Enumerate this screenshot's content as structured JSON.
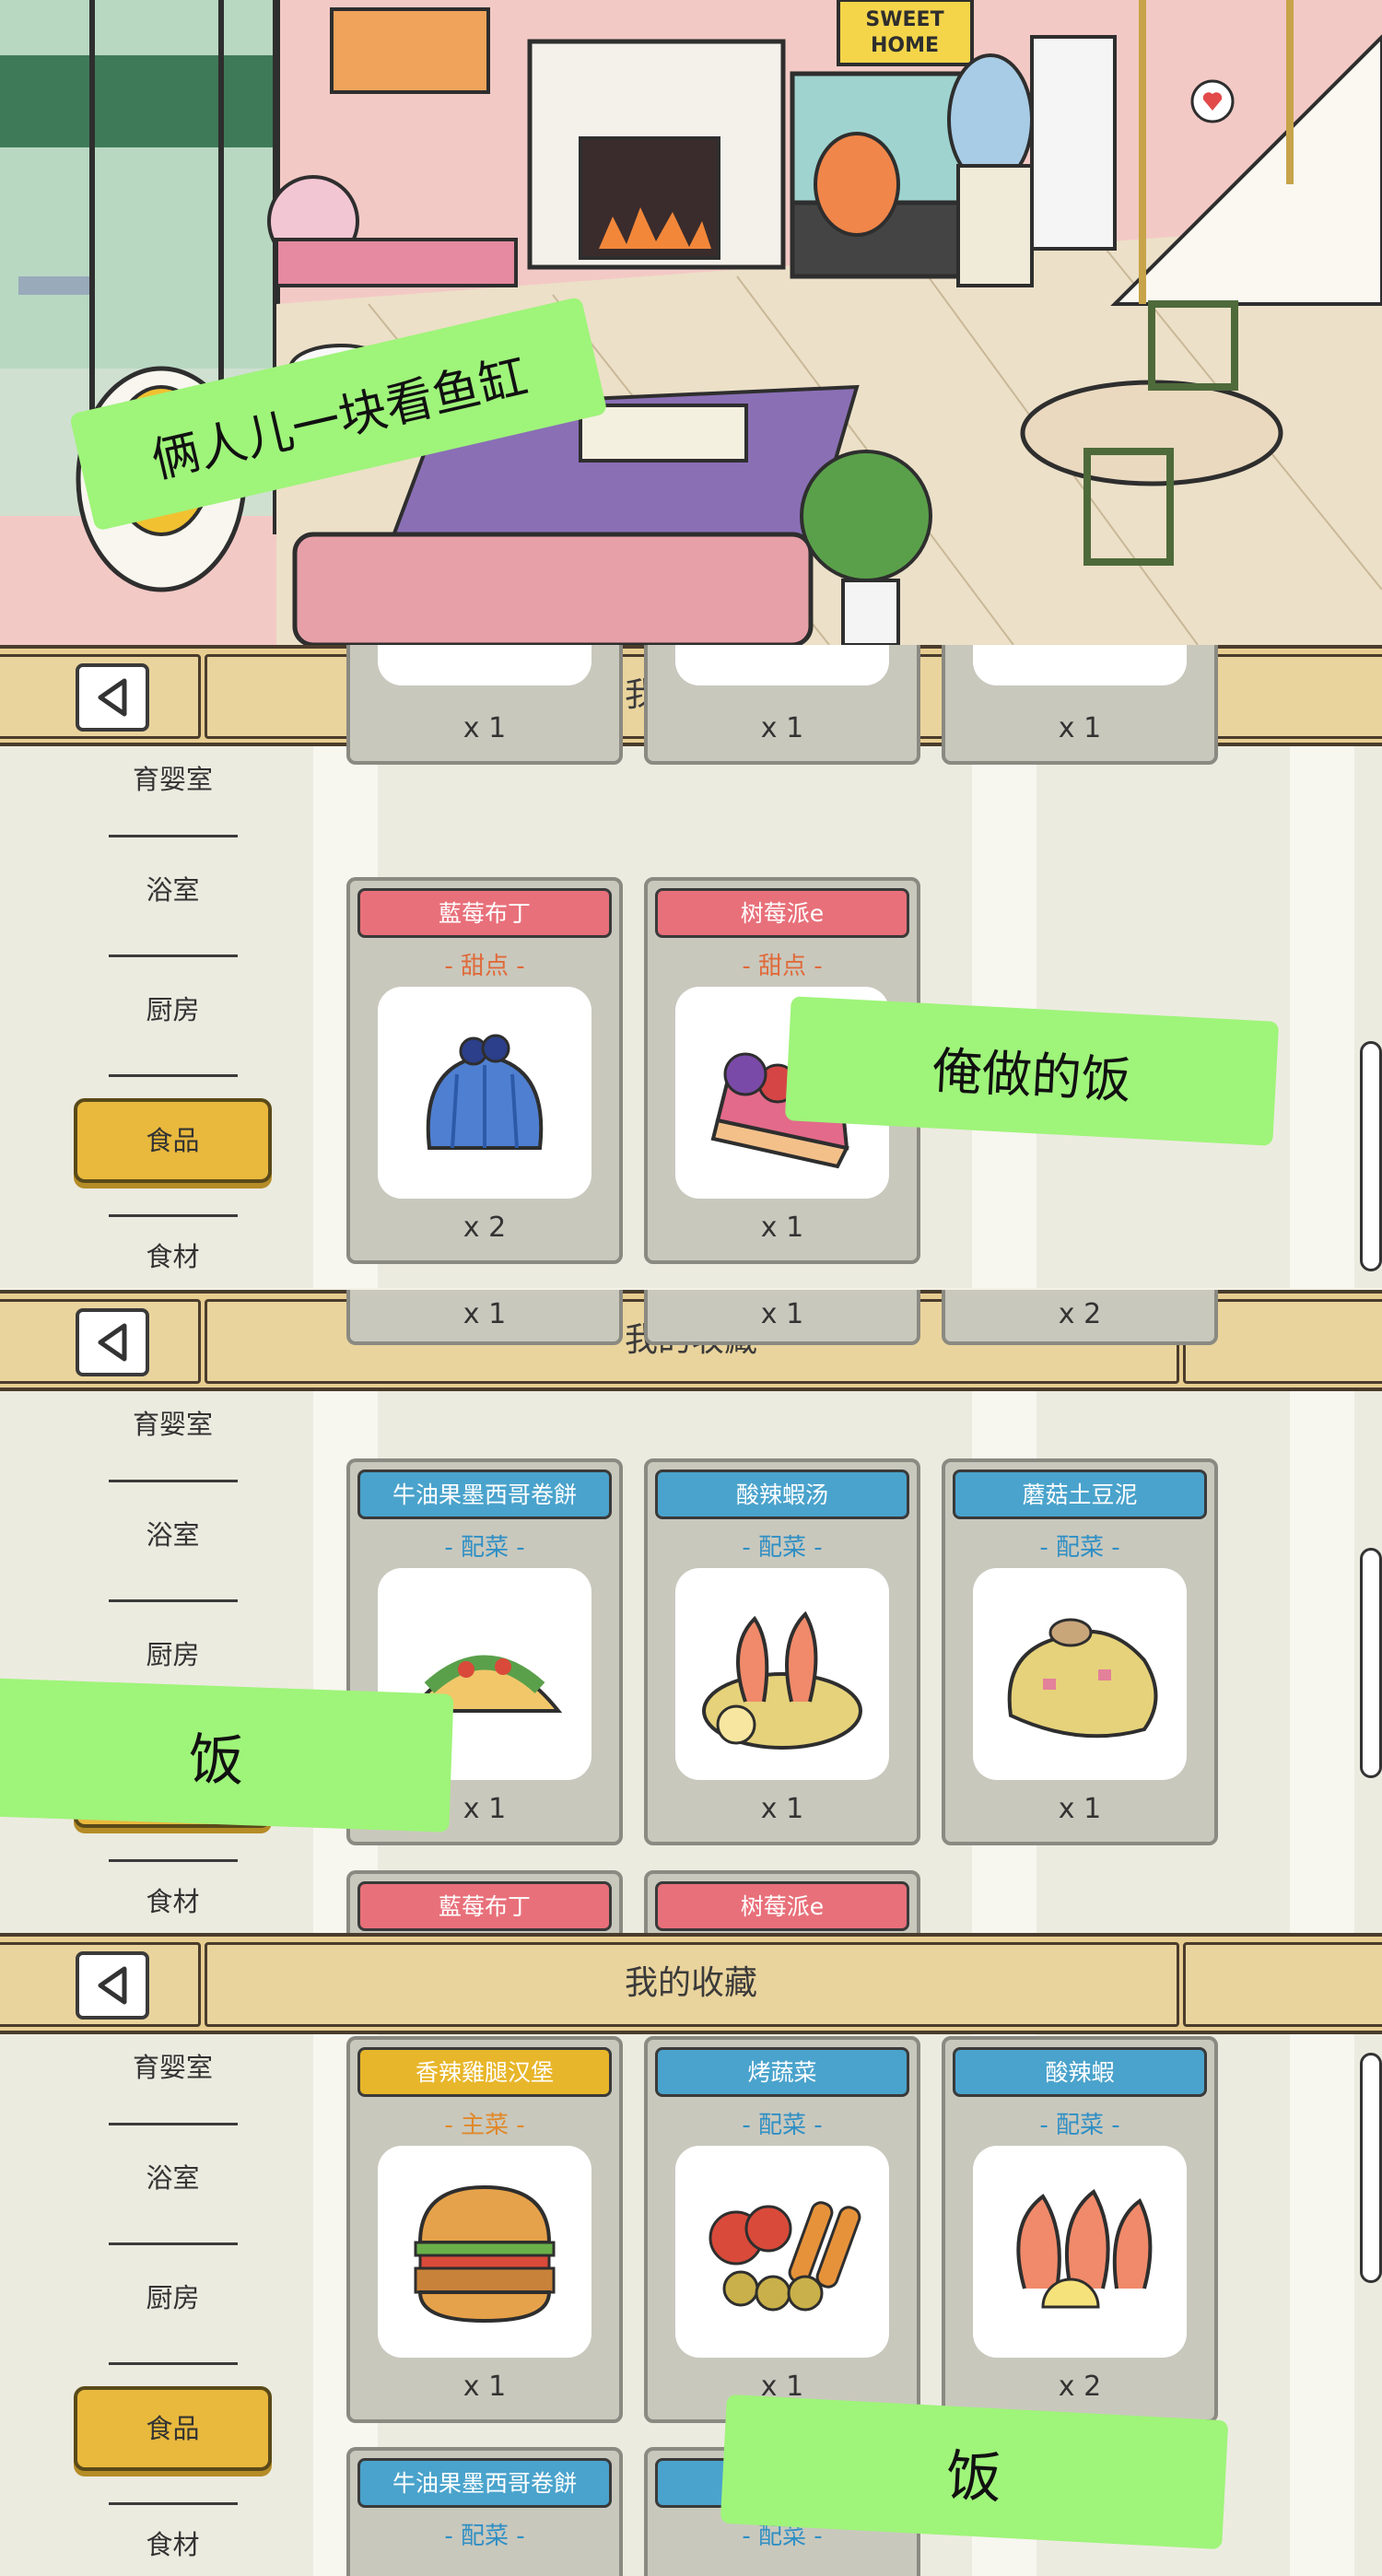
{
  "scene": {
    "sign_line1": "SWEET",
    "sign_line2": "HOME"
  },
  "captions": {
    "scene_caption": "俩人儿一块看鱼缸",
    "panel1_caption": "俺做的饭",
    "panel2_caption": "饭",
    "panel3_caption": "饭"
  },
  "header": {
    "title": "我的收藏"
  },
  "sidebar": {
    "items": [
      "育婴室",
      "浴室",
      "厨房",
      "食品",
      "食材"
    ],
    "active": "食品"
  },
  "panel1": {
    "top_quantities": [
      "x 1",
      "x 1",
      "x 1"
    ],
    "cards": [
      {
        "name": "藍莓布丁",
        "category": "- 甜点 -",
        "quantity": "x 2",
        "icon": "blueberry-pudding-icon"
      },
      {
        "name": "树莓派e",
        "category": "- 甜点 -",
        "quantity": "x 1",
        "icon": "raspberry-pie-icon"
      }
    ]
  },
  "panel2": {
    "top_quantities": [
      "x 1",
      "x 1",
      "x 2"
    ],
    "cards": [
      {
        "name": "牛油果墨西哥卷餅",
        "category": "- 配菜 -",
        "quantity": "x 1",
        "icon": "taco-icon"
      },
      {
        "name": "酸辣蝦汤",
        "category": "- 配菜 -",
        "quantity": "x 1",
        "icon": "shrimp-soup-icon"
      },
      {
        "name": "蘑菇土豆泥",
        "category": "- 配菜 -",
        "quantity": "x 1",
        "icon": "mashed-potato-icon"
      }
    ],
    "bottom_names": [
      "藍莓布丁",
      "树莓派e"
    ]
  },
  "panel3": {
    "cards": [
      {
        "name": "香辣雞腿汉堡",
        "category": "- 主菜 -",
        "quantity": "x 1",
        "icon": "burger-icon"
      },
      {
        "name": "烤蔬菜",
        "category": "- 配菜 -",
        "quantity": "x 1",
        "icon": "roasted-vegetables-icon"
      },
      {
        "name": "酸辣蝦",
        "category": "- 配菜 -",
        "quantity": "x 2",
        "icon": "shrimp-icon"
      }
    ],
    "bottom_cards": [
      {
        "name": "牛油果墨西哥卷餅",
        "category": "- 配菜 -"
      },
      {
        "name": "",
        "category": "- 配菜 -"
      }
    ]
  },
  "colors": {
    "dessert_tag": "#e8707a",
    "dessert_text": "#e06a3a",
    "side_tag": "#4aa3cc",
    "side_text": "#2f8fc4",
    "main_tag": "#e8b62a",
    "main_text": "#e0892a",
    "caption_bg": "#9ff47a",
    "active_nav": "#e9b93d"
  }
}
